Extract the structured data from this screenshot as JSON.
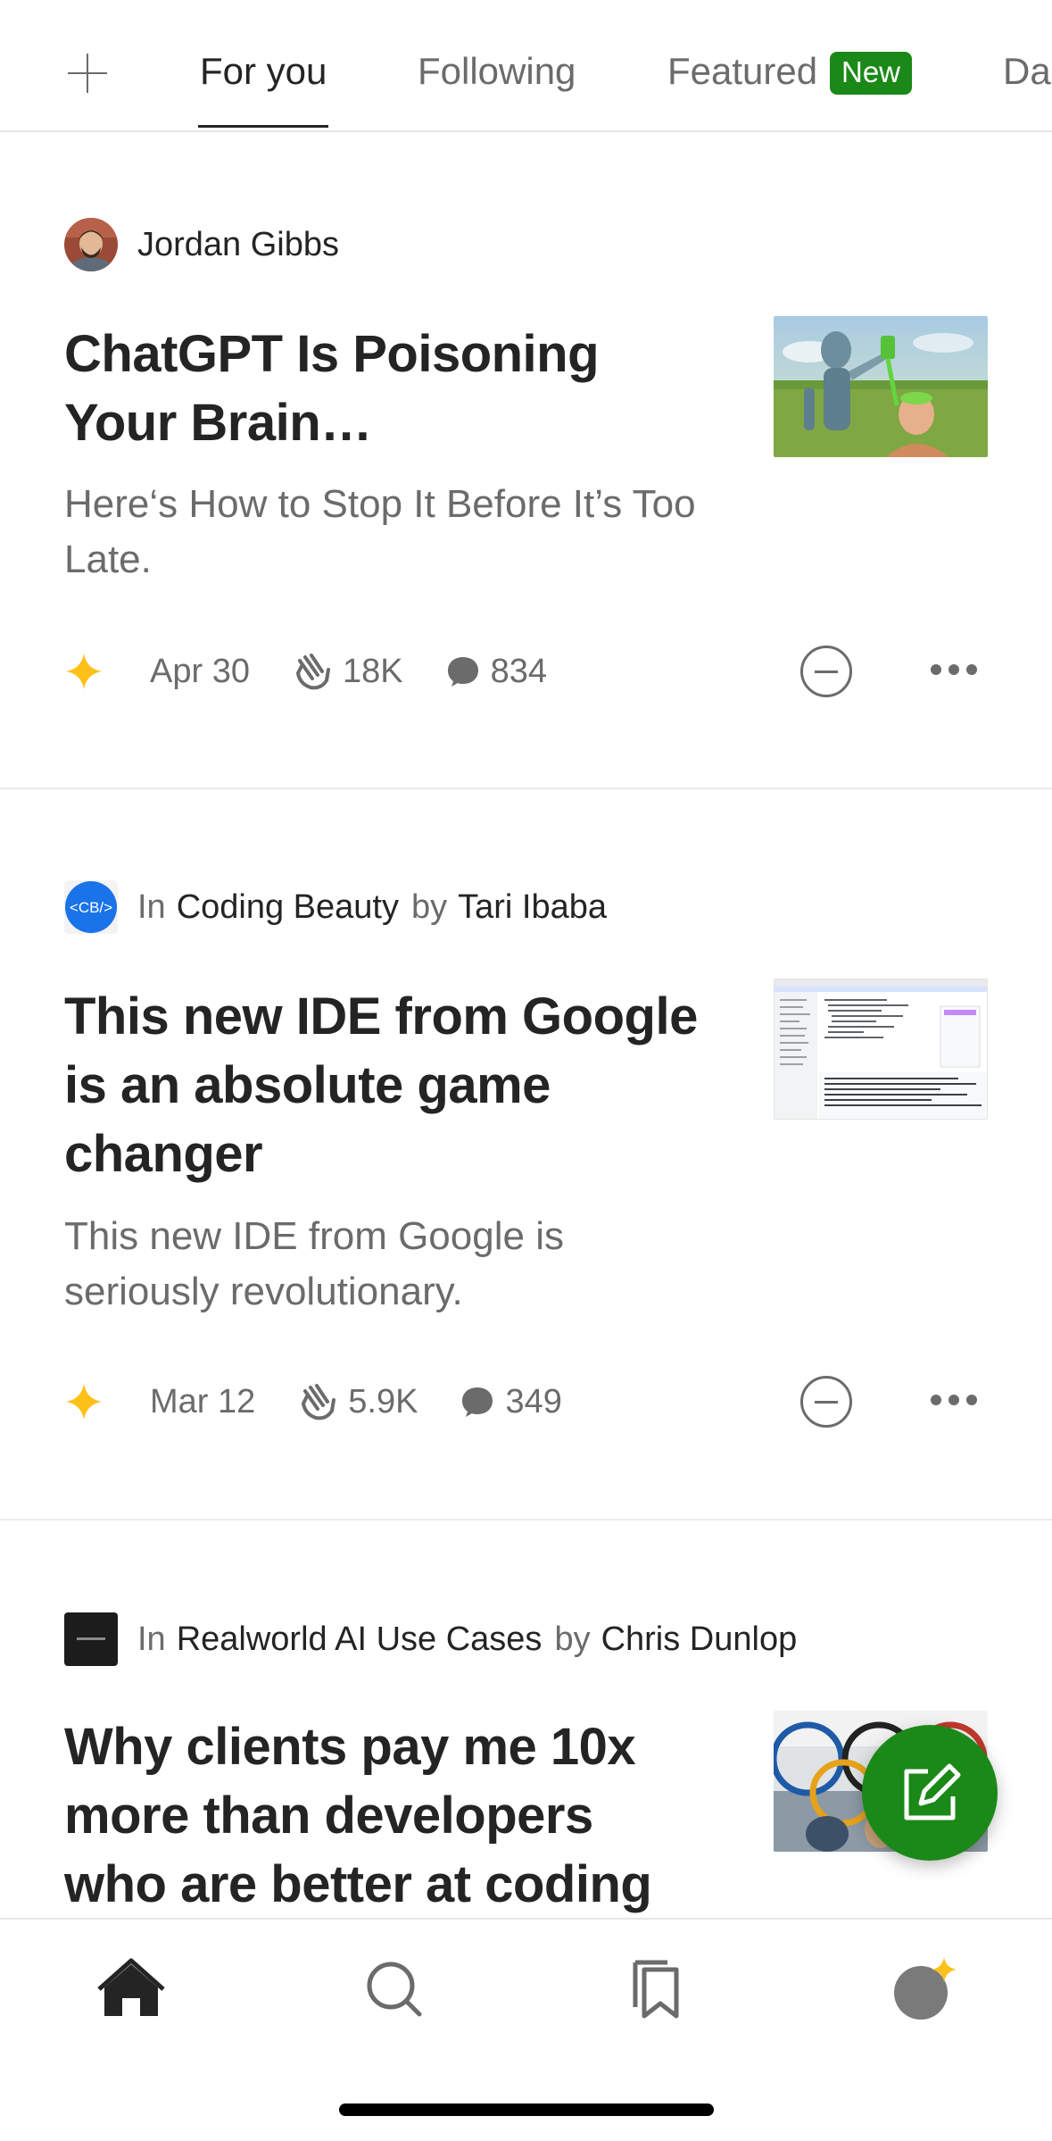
{
  "tabs": [
    {
      "label": "For you",
      "active": true
    },
    {
      "label": "Following",
      "active": false
    },
    {
      "label": "Featured",
      "active": false,
      "badge": "New"
    },
    {
      "label": "Da",
      "active": false
    }
  ],
  "articles": [
    {
      "byline": {
        "author": "Jordan Gibbs"
      },
      "title": "ChatGPT Is Poisoning Your Brain…",
      "subtitle": "Here‘s How to Stop It Before It’s Too Late.",
      "date": "Apr 30",
      "claps": "18K",
      "responses": "834",
      "member_only": true
    },
    {
      "byline": {
        "in_label": "In",
        "publication": "Coding Beauty",
        "by_label": "by",
        "author": "Tari Ibaba",
        "logo_text": "<CB/>"
      },
      "title": "This new IDE from Google is an absolute game changer",
      "subtitle": "This new IDE from Google is seriously revolutionary.",
      "date": "Mar 12",
      "claps": "5.9K",
      "responses": "349",
      "member_only": true
    },
    {
      "byline": {
        "in_label": "In",
        "publication": "Realworld AI Use Cases",
        "by_label": "by",
        "author": "Chris Dunlop"
      },
      "title": "Why clients pay me 10x more than developers who are better at coding"
    }
  ],
  "bottom_nav": [
    "home-icon",
    "search-icon",
    "bookmarks-icon",
    "profile-icon"
  ],
  "colors": {
    "accent": "#1a8917",
    "star": "#ffc017",
    "text": "#242424",
    "muted": "#6b6b6b",
    "coding_beauty": "#1a73e8"
  }
}
